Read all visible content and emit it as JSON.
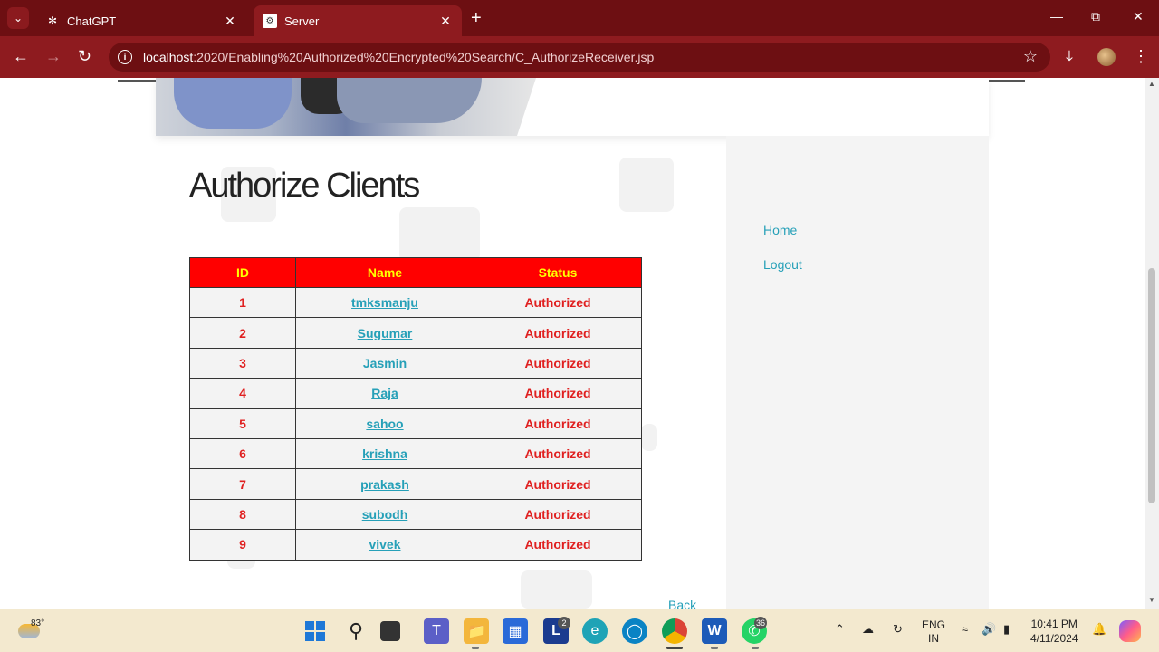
{
  "browser": {
    "tabs": [
      {
        "title": "ChatGPT",
        "active": false
      },
      {
        "title": "Server",
        "active": true
      }
    ],
    "url_host": "localhost",
    "url_path": ":2020/Enabling%20Authorized%20Encrypted%20Search/C_AuthorizeReceiver.jsp"
  },
  "page": {
    "title": "Authorize Clients",
    "table": {
      "headers": [
        "ID",
        "Name",
        "Status"
      ],
      "rows": [
        {
          "id": "1",
          "name": "tmksmanju",
          "status": "Authorized"
        },
        {
          "id": "2",
          "name": "Sugumar",
          "status": "Authorized"
        },
        {
          "id": "3",
          "name": "Jasmin",
          "status": "Authorized"
        },
        {
          "id": "4",
          "name": "Raja",
          "status": "Authorized"
        },
        {
          "id": "5",
          "name": "sahoo",
          "status": "Authorized"
        },
        {
          "id": "6",
          "name": "krishna",
          "status": "Authorized"
        },
        {
          "id": "7",
          "name": "prakash",
          "status": "Authorized"
        },
        {
          "id": "8",
          "name": "subodh",
          "status": "Authorized"
        },
        {
          "id": "9",
          "name": "vivek",
          "status": "Authorized"
        }
      ]
    },
    "back_label": "Back"
  },
  "sidebar": {
    "links": [
      "Home",
      "Logout"
    ]
  },
  "taskbar": {
    "weather_temp": "83°",
    "teams_badge": "2",
    "whatsapp_badge": "36",
    "lang_line1": "ENG",
    "lang_line2": "IN",
    "time": "10:41 PM",
    "date": "4/11/2024"
  },
  "colors": {
    "header_bg": "#ff0000",
    "header_text": "#ffff00",
    "status_text": "#e02020",
    "link": "#26a0b8",
    "browser_frame": "#8e1b1f"
  }
}
